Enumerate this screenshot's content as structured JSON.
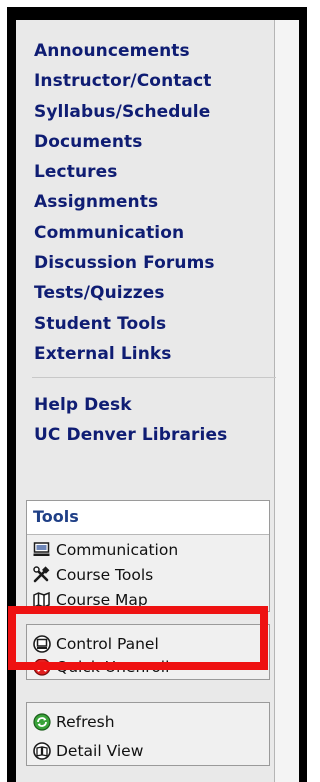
{
  "nav": {
    "links": [
      "Announcements",
      "Instructor/Contact",
      "Syllabus/Schedule",
      "Documents",
      "Lectures",
      "Assignments",
      "Communication",
      "Discussion Forums",
      "Tests/Quizzes",
      "Student Tools",
      "External Links"
    ],
    "help_links": [
      "Help Desk",
      "UC Denver Libraries"
    ]
  },
  "tools": {
    "header": "Tools",
    "items": [
      {
        "label": "Communication",
        "icon": "computer-icon"
      },
      {
        "label": "Course Tools",
        "icon": "tools-icon"
      },
      {
        "label": "Course Map",
        "icon": "map-icon"
      }
    ]
  },
  "box2": {
    "items": [
      {
        "label": "Control Panel",
        "icon": "control-panel-icon"
      },
      {
        "label": "Quick Unenroll",
        "icon": "unenroll-icon"
      }
    ]
  },
  "box3": {
    "items": [
      {
        "label": "Refresh",
        "icon": "refresh-icon"
      },
      {
        "label": "Detail View",
        "icon": "detail-view-icon"
      }
    ]
  },
  "colors": {
    "link": "#0f1d73",
    "tools_header": "#1f3f86",
    "highlight": "#ee1111",
    "panel_bg": "#e9e9e9"
  }
}
